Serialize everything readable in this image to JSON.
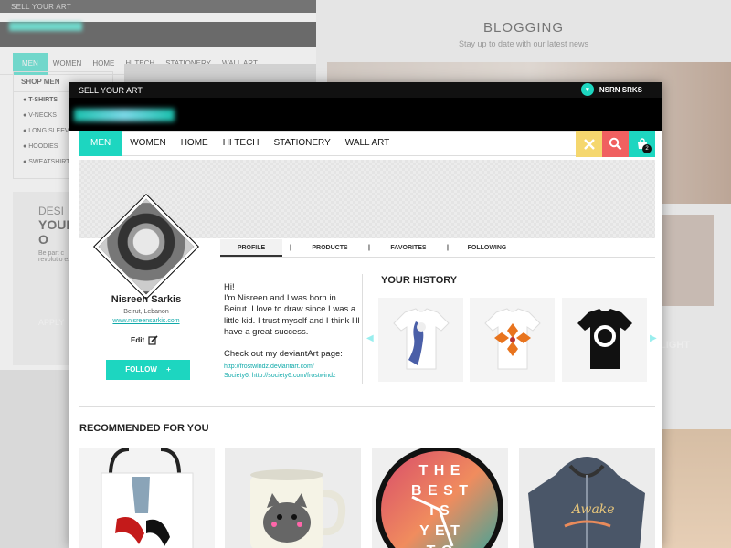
{
  "bg_left": {
    "topbar": "SELL YOUR ART",
    "nav": [
      "MEN",
      "WOMEN",
      "HOME",
      "HI TECH",
      "STATIONERY",
      "WALL ART"
    ],
    "shop_title": "SHOP MEN",
    "shop_items": [
      "T-SHIRTS",
      "V-NECKS",
      "LONG SLEEVE",
      "HOODIES",
      "SWEATSHIRTS"
    ],
    "banner_top": "DESI",
    "banner_big": "YOUR O",
    "banner_text": "Be part c revolutio expres",
    "banner_btn": "APPLY"
  },
  "bg_right": {
    "title": "BLOGGING",
    "subtitle": "Stay up to date with our latest news",
    "light_label": "LIGHT"
  },
  "topbar": {
    "title": "SELL YOUR ART",
    "user": "NSRN SRKS"
  },
  "nav": {
    "items": [
      "MEN",
      "WOMEN",
      "HOME",
      "HI TECH",
      "STATIONERY",
      "WALL ART"
    ],
    "cart_count": "2",
    "colors": {
      "accent": "#1dd6c0",
      "tools": "#f5d76e",
      "search": "#f06060",
      "cart": "#1dd6c0"
    }
  },
  "tabs": [
    "PROFILE",
    "|",
    "PRODUCTS",
    "|",
    "FAVORITES",
    "|",
    "FOLLOWING"
  ],
  "profile": {
    "name": "Nisreen Sarkis",
    "location": "Beirut, Lebanon",
    "website": "www.nisreensarkis.com",
    "edit": "Edit",
    "follow": "FOLLOW",
    "follow_icon": "+"
  },
  "bio": {
    "greeting": "Hi!",
    "text": "I'm Nisreen and I was born in Beirut. I love to draw since I was a little kid. I trust myself and I think I'll have a great success.",
    "check": "Check out my deviantArt page:",
    "link1": "http://frostwindz.deviantart.com/",
    "link2": "Society6: http://society6.com/frostwindz"
  },
  "history": {
    "title": "YOUR HISTORY"
  },
  "recommended": {
    "title": "RECOMMENDED FOR YOU",
    "clock_text": [
      "T H E",
      "B E S T",
      "I S",
      "Y E T",
      "T O"
    ]
  }
}
